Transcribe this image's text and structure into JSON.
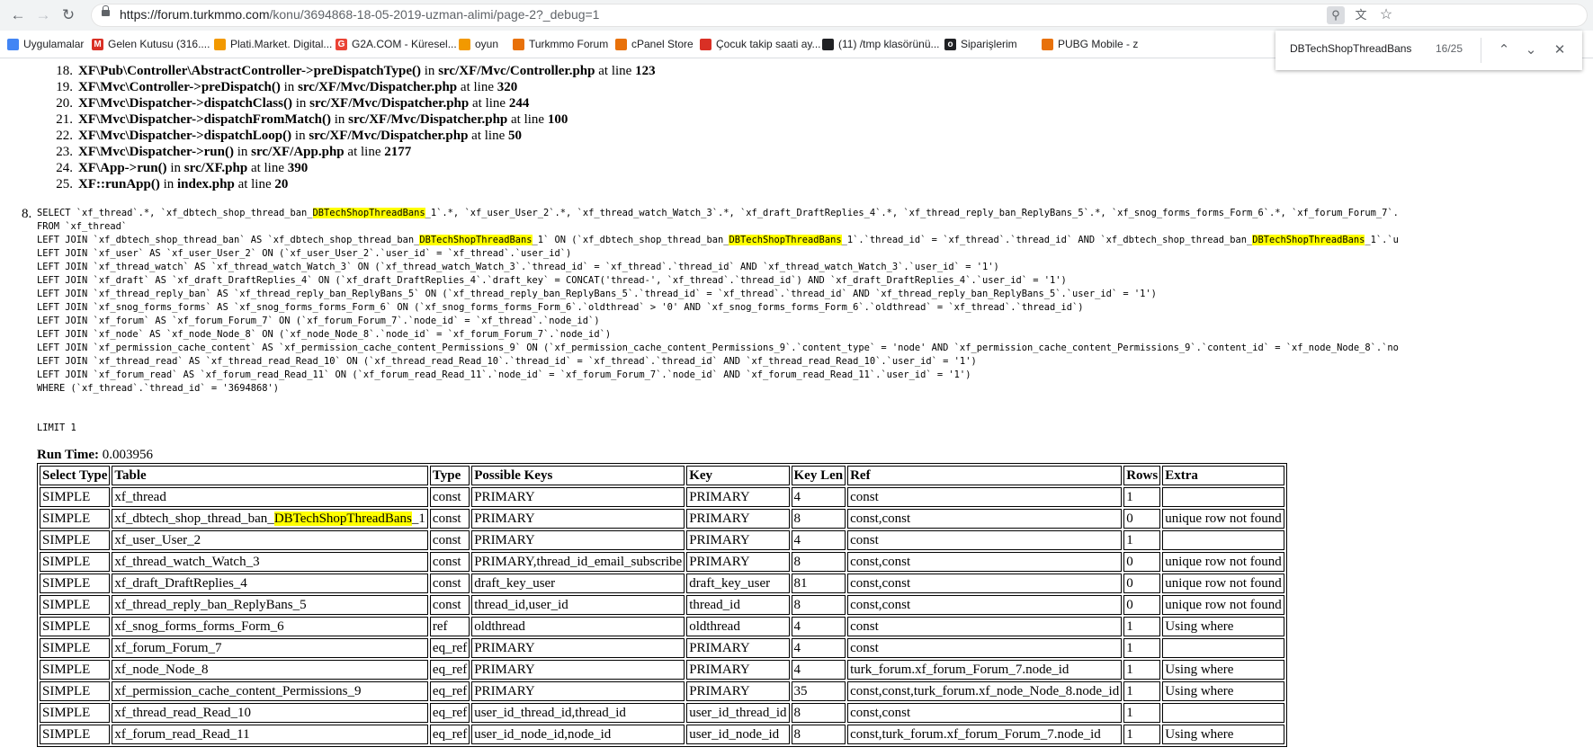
{
  "browser": {
    "url_host": "https://forum.turkmmo.com",
    "url_path": "/konu/3694868-18-05-2019-uzman-alimi/page-2?_debug=1",
    "bookmarks": [
      {
        "label": "Uygulamalar",
        "color": "#4285f4"
      },
      {
        "label": "Gelen Kutusu (316....",
        "color": "#d93025",
        "glyph": "M"
      },
      {
        "label": "Plati.Market. Digital...",
        "color": "#f29900"
      },
      {
        "label": "G2A.COM - Küresel...",
        "color": "#ea4335",
        "glyph": "G"
      },
      {
        "label": "oyun",
        "color": "#f29900"
      },
      {
        "label": "Turkmmo Forum",
        "color": "#e8710a"
      },
      {
        "label": "cPanel Store",
        "color": "#e8710a"
      },
      {
        "label": "Çocuk takip saati ay...",
        "color": "#d93025"
      },
      {
        "label": "(11) /tmp klasörünü...",
        "color": "#202124"
      },
      {
        "label": "Siparişlerim",
        "color": "#202124",
        "glyph": "ok"
      },
      {
        "label": "PUBG Mobile - z",
        "color": "#e8710a"
      }
    ]
  },
  "find": {
    "query": "DBTechShopThreadBans",
    "count": "16/25"
  },
  "trace": [
    {
      "n": "18.",
      "cls": "XF\\Pub\\Controller\\AbstractController->preDispatchType()",
      "mid": " in ",
      "file": "src/XF/Mvc/Controller.php",
      "at": " at line ",
      "line": "123"
    },
    {
      "n": "19.",
      "cls": "XF\\Mvc\\Controller->preDispatch()",
      "mid": " in ",
      "file": "src/XF/Mvc/Dispatcher.php",
      "at": " at line ",
      "line": "320"
    },
    {
      "n": "20.",
      "cls": "XF\\Mvc\\Dispatcher->dispatchClass()",
      "mid": " in ",
      "file": "src/XF/Mvc/Dispatcher.php",
      "at": " at line ",
      "line": "244"
    },
    {
      "n": "21.",
      "cls": "XF\\Mvc\\Dispatcher->dispatchFromMatch()",
      "mid": " in ",
      "file": "src/XF/Mvc/Dispatcher.php",
      "at": " at line ",
      "line": "100"
    },
    {
      "n": "22.",
      "cls": "XF\\Mvc\\Dispatcher->dispatchLoop()",
      "mid": " in ",
      "file": "src/XF/Mvc/Dispatcher.php",
      "at": " at line ",
      "line": "50"
    },
    {
      "n": "23.",
      "cls": "XF\\Mvc\\Dispatcher->run()",
      "mid": " in ",
      "file": "src/XF/App.php",
      "at": " at line ",
      "line": "2177"
    },
    {
      "n": "24.",
      "cls": "XF\\App->run()",
      "mid": " in ",
      "file": "src/XF.php",
      "at": " at line ",
      "line": "390"
    },
    {
      "n": "25.",
      "cls": "XF::runApp()",
      "mid": " in ",
      "file": "index.php",
      "at": " at line ",
      "line": "20"
    }
  ],
  "query": {
    "number": "8.",
    "lines": [
      "SELECT `xf_thread`.*, `xf_dbtech_shop_thread_ban_DBTechShopThreadBans_1`.*, `xf_user_User_2`.*, `xf_thread_watch_Watch_3`.*, `xf_draft_DraftReplies_4`.*, `xf_thread_reply_ban_ReplyBans_5`.*, `xf_snog_forms_forms_Form_6`.*, `xf_forum_Forum_7`.",
      "FROM `xf_thread`",
      "LEFT JOIN `xf_dbtech_shop_thread_ban` AS `xf_dbtech_shop_thread_ban_DBTechShopThreadBans_1` ON (`xf_dbtech_shop_thread_ban_DBTechShopThreadBans_1`.`thread_id` = `xf_thread`.`thread_id` AND `xf_dbtech_shop_thread_ban_DBTechShopThreadBans_1`.`u",
      "LEFT JOIN `xf_user` AS `xf_user_User_2` ON (`xf_user_User_2`.`user_id` = `xf_thread`.`user_id`)",
      "LEFT JOIN `xf_thread_watch` AS `xf_thread_watch_Watch_3` ON (`xf_thread_watch_Watch_3`.`thread_id` = `xf_thread`.`thread_id` AND `xf_thread_watch_Watch_3`.`user_id` = '1')",
      "LEFT JOIN `xf_draft` AS `xf_draft_DraftReplies_4` ON (`xf_draft_DraftReplies_4`.`draft_key` = CONCAT('thread-', `xf_thread`.`thread_id`) AND `xf_draft_DraftReplies_4`.`user_id` = '1')",
      "LEFT JOIN `xf_thread_reply_ban` AS `xf_thread_reply_ban_ReplyBans_5` ON (`xf_thread_reply_ban_ReplyBans_5`.`thread_id` = `xf_thread`.`thread_id` AND `xf_thread_reply_ban_ReplyBans_5`.`user_id` = '1')",
      "LEFT JOIN `xf_snog_forms_forms` AS `xf_snog_forms_forms_Form_6` ON (`xf_snog_forms_forms_Form_6`.`oldthread` > '0' AND `xf_snog_forms_forms_Form_6`.`oldthread` = `xf_thread`.`thread_id`)",
      "LEFT JOIN `xf_forum` AS `xf_forum_Forum_7` ON (`xf_forum_Forum_7`.`node_id` = `xf_thread`.`node_id`)",
      "LEFT JOIN `xf_node` AS `xf_node_Node_8` ON (`xf_node_Node_8`.`node_id` = `xf_forum_Forum_7`.`node_id`)",
      "LEFT JOIN `xf_permission_cache_content` AS `xf_permission_cache_content_Permissions_9` ON (`xf_permission_cache_content_Permissions_9`.`content_type` = 'node' AND `xf_permission_cache_content_Permissions_9`.`content_id` = `xf_node_Node_8`.`no",
      "LEFT JOIN `xf_thread_read` AS `xf_thread_read_Read_10` ON (`xf_thread_read_Read_10`.`thread_id` = `xf_thread`.`thread_id` AND `xf_thread_read_Read_10`.`user_id` = '1')",
      "LEFT JOIN `xf_forum_read` AS `xf_forum_read_Read_11` ON (`xf_forum_read_Read_11`.`node_id` = `xf_forum_Forum_7`.`node_id` AND `xf_forum_read_Read_11`.`user_id` = '1')",
      "WHERE (`xf_thread`.`thread_id` = '3694868')"
    ],
    "limit": "LIMIT 1",
    "run_time_label": "Run Time:",
    "run_time_value": "0.003956"
  },
  "explain": {
    "columns": [
      "Select Type",
      "Table",
      "Type",
      "Possible Keys",
      "Key",
      "Key Len",
      "Ref",
      "Rows",
      "Extra"
    ],
    "rows": [
      [
        "SIMPLE",
        "xf_thread",
        "const",
        "PRIMARY",
        "PRIMARY",
        "4",
        "const",
        "1",
        ""
      ],
      [
        "SIMPLE",
        "xf_dbtech_shop_thread_ban_DBTechShopThreadBans_1",
        "const",
        "PRIMARY",
        "PRIMARY",
        "8",
        "const,const",
        "0",
        "unique row not found"
      ],
      [
        "SIMPLE",
        "xf_user_User_2",
        "const",
        "PRIMARY",
        "PRIMARY",
        "4",
        "const",
        "1",
        ""
      ],
      [
        "SIMPLE",
        "xf_thread_watch_Watch_3",
        "const",
        "PRIMARY,thread_id_email_subscribe",
        "PRIMARY",
        "8",
        "const,const",
        "0",
        "unique row not found"
      ],
      [
        "SIMPLE",
        "xf_draft_DraftReplies_4",
        "const",
        "draft_key_user",
        "draft_key_user",
        "81",
        "const,const",
        "0",
        "unique row not found"
      ],
      [
        "SIMPLE",
        "xf_thread_reply_ban_ReplyBans_5",
        "const",
        "thread_id,user_id",
        "thread_id",
        "8",
        "const,const",
        "0",
        "unique row not found"
      ],
      [
        "SIMPLE",
        "xf_snog_forms_forms_Form_6",
        "ref",
        "oldthread",
        "oldthread",
        "4",
        "const",
        "1",
        "Using where"
      ],
      [
        "SIMPLE",
        "xf_forum_Forum_7",
        "eq_ref",
        "PRIMARY",
        "PRIMARY",
        "4",
        "const",
        "1",
        ""
      ],
      [
        "SIMPLE",
        "xf_node_Node_8",
        "eq_ref",
        "PRIMARY",
        "PRIMARY",
        "4",
        "turk_forum.xf_forum_Forum_7.node_id",
        "1",
        "Using where"
      ],
      [
        "SIMPLE",
        "xf_permission_cache_content_Permissions_9",
        "eq_ref",
        "PRIMARY",
        "PRIMARY",
        "35",
        "const,const,turk_forum.xf_node_Node_8.node_id",
        "1",
        "Using where"
      ],
      [
        "SIMPLE",
        "xf_thread_read_Read_10",
        "eq_ref",
        "user_id_thread_id,thread_id",
        "user_id_thread_id",
        "8",
        "const,const",
        "1",
        ""
      ],
      [
        "SIMPLE",
        "xf_forum_read_Read_11",
        "eq_ref",
        "user_id_node_id,node_id",
        "user_id_node_id",
        "8",
        "const,turk_forum.xf_forum_Forum_7.node_id",
        "1",
        "Using where"
      ]
    ]
  },
  "colors": {
    "highlight": "#ffff00",
    "chrome": "#f1f3f4"
  }
}
